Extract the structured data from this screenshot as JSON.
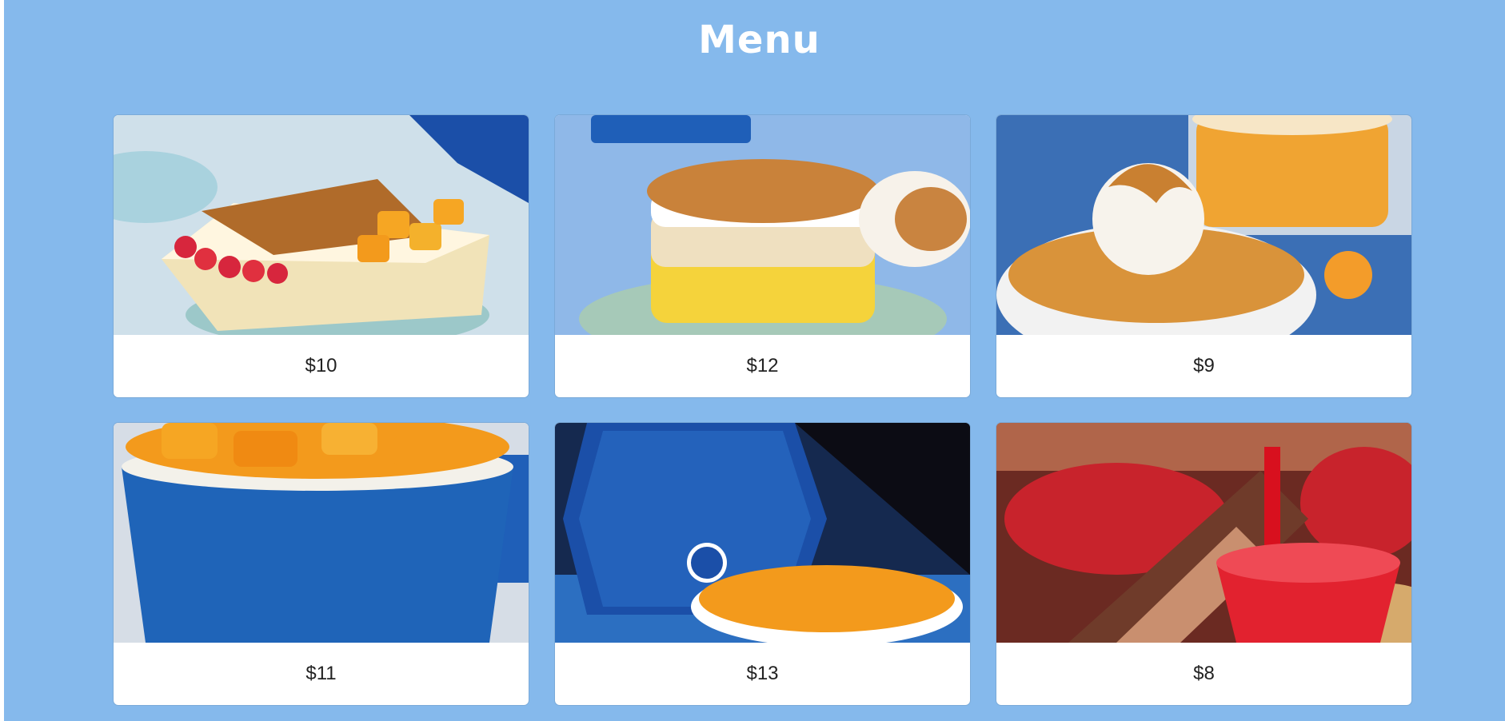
{
  "page": {
    "title": "Menu"
  },
  "menu": {
    "items": [
      {
        "price": "$10",
        "image_desc": "mango-strawberry-konafa-cake"
      },
      {
        "price": "$12",
        "image_desc": "lotus-konafa-cake"
      },
      {
        "price": "$9",
        "image_desc": "lotus-ice-cream-cup"
      },
      {
        "price": "$11",
        "image_desc": "mango-koshari-cup"
      },
      {
        "price": "$13",
        "image_desc": "almazcya-mango-box"
      },
      {
        "price": "$8",
        "image_desc": "strawberry-juice-bottle"
      }
    ]
  },
  "colors": {
    "background": "#85b9ec",
    "card": "#ffffff",
    "brand_blue": "#1f5fb8",
    "mango": "#f6a623",
    "strawberry": "#d7263d"
  }
}
